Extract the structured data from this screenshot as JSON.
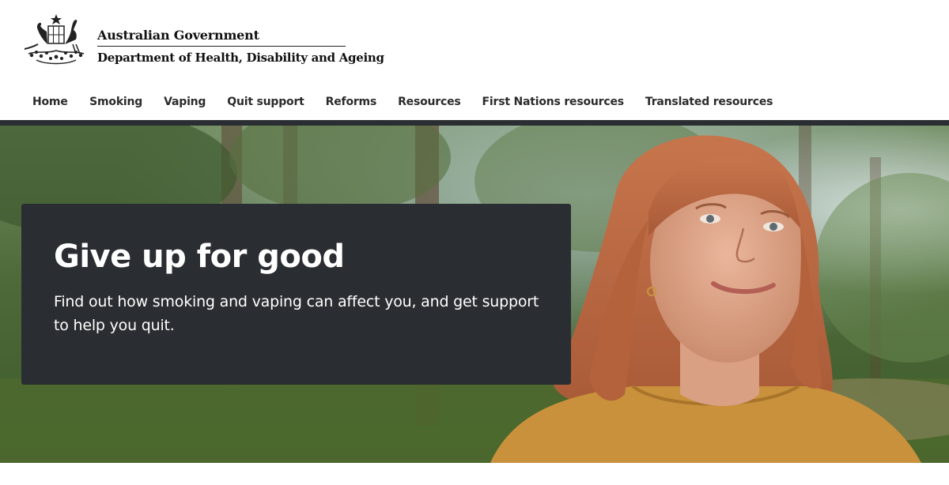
{
  "header": {
    "gov_name": "Australian Government",
    "department": "Department of Health, Disability and Ageing",
    "crest_icon": "australian-coat-of-arms-icon"
  },
  "nav": {
    "items": [
      {
        "label": "Home",
        "active": true
      },
      {
        "label": "Smoking",
        "active": false
      },
      {
        "label": "Vaping",
        "active": false
      },
      {
        "label": "Quit support",
        "active": false
      },
      {
        "label": "Reforms",
        "active": false
      },
      {
        "label": "Resources",
        "active": false
      },
      {
        "label": "First Nations resources",
        "active": false
      },
      {
        "label": "Translated resources",
        "active": false
      }
    ]
  },
  "hero": {
    "title": "Give up for good",
    "text": "Find out how smoking and vaping can affect you, and get support to help you quit."
  },
  "colors": {
    "nav_bar": "#2a2d31",
    "card_bg": "#2a2d31",
    "text_on_dark": "#ffffff"
  }
}
